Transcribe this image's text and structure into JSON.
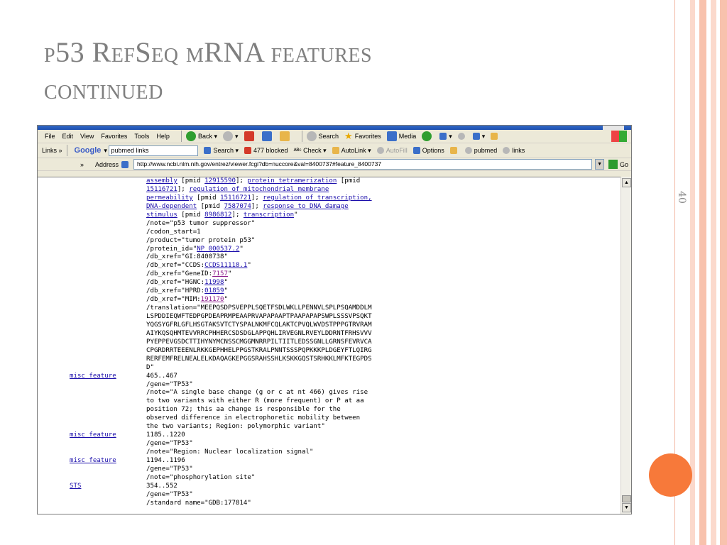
{
  "slide": {
    "title_line1": "p53 RefSeq mRNA features",
    "title_line2": "continued",
    "page_number": "40"
  },
  "browser": {
    "menu": [
      "File",
      "Edit",
      "View",
      "Favorites",
      "Tools",
      "Help"
    ],
    "toolbar": {
      "back": "Back",
      "search": "Search",
      "favorites": "Favorites",
      "media": "Media"
    },
    "links_bar": {
      "links": "Links",
      "google": "Google",
      "search_value": "pubmed links",
      "search": "Search",
      "blocked": "477 blocked",
      "check": "Check",
      "autolink": "AutoLink",
      "autofill": "AutoFill",
      "options": "Options",
      "pubmed": "pubmed",
      "links_btn": "links"
    },
    "address": {
      "label": "Address",
      "url": "http://www.ncbi.nlm.nih.gov/entrez/viewer.fcgi?db=nuccore&val=8400737#feature_8400737",
      "go": "Go"
    }
  },
  "genbank": {
    "top_lines": [
      [
        {
          "t": "assembly",
          "link": true
        },
        " [pmid ",
        {
          "t": "12915590",
          "link": true
        },
        "]; ",
        {
          "t": "protein tetramerization",
          "link": true
        },
        " [pmid"
      ],
      [
        {
          "t": "15116721",
          "link": true
        },
        "]; ",
        {
          "t": "regulation of mitochondrial membrane",
          "link": true
        }
      ],
      [
        {
          "t": "permeability",
          "link": true
        },
        " [pmid ",
        {
          "t": "15116721",
          "link": true
        },
        "]; ",
        {
          "t": "regulation of transcription,",
          "link": true
        }
      ],
      [
        {
          "t": "DNA-dependent",
          "link": true
        },
        " [pmid ",
        {
          "t": "7587074",
          "link": true
        },
        "]; ",
        {
          "t": "response to DNA damage",
          "link": true
        }
      ],
      [
        {
          "t": "stimulus",
          "link": true
        },
        " [pmid ",
        {
          "t": "8986812",
          "link": true
        },
        "]; ",
        {
          "t": "transcription",
          "link": true
        },
        "\""
      ],
      [
        "/note=\"p53 tumor suppressor\""
      ],
      [
        "/codon_start=1"
      ],
      [
        "/product=\"tumor protein p53\""
      ],
      [
        "/protein_id=\"",
        {
          "t": "NP_000537.2",
          "link": true
        },
        "\""
      ],
      [
        "/db_xref=\"GI:8400738\""
      ],
      [
        "/db_xref=\"CCDS:",
        {
          "t": "CCDS11118.1",
          "link": true
        },
        "\""
      ],
      [
        "/db_xref=\"GeneID:",
        {
          "t": "7157",
          "link": true,
          "visited": true
        },
        "\""
      ],
      [
        "/db_xref=\"HGNC:",
        {
          "t": "11998",
          "link": true
        },
        "\""
      ],
      [
        "/db_xref=\"HPRD:",
        {
          "t": "01859",
          "link": true
        },
        "\""
      ],
      [
        "/db_xref=\"MIM:",
        {
          "t": "191170",
          "link": true,
          "visited": true
        },
        "\""
      ],
      [
        "/translation=\"MEEPQSDPSVEPPLSQETFSDLWKLLPENNVLSPLPSQAMDDLM"
      ],
      [
        "LSPDDIEQWFTEDPGPDEAPRMPEAAPRVAPAPAAPTPAAPAPAPSWPLSSSVPSQKT"
      ],
      [
        "YQGSYGFRLGFLHSGTAKSVTCTYSPALNKMFCQLAKTCPVQLWVDSTPPPGTRVRAM"
      ],
      [
        "AIYKQSQHMTEVVRRCPHHERCSDSDGLAPPQHLIRVEGNLRVEYLDDRNTFRHSVVV"
      ],
      [
        "PYEPPEVGSDCTTIHYNYMCNSSCMGGMNRRPILTIITLEDSSGNLLGRNSFEVRVCA"
      ],
      [
        "CPGRDRRTEEENLRKKGEPHHELPPGSTKRALPNNTSSSPQPKKKPLDGEYFTLQIRG"
      ],
      [
        "RERFEMFRELNEALELKDAQAGKEPGGSRAHSSHLKSKKGQSTSRHKKLMFKTEGPDS"
      ],
      [
        "D\""
      ]
    ],
    "features": [
      {
        "key": "misc_feature",
        "lines": [
          "465..467",
          "/gene=\"TP53\"",
          "/note=\"A single base change (g or c at nt 466) gives rise",
          "to two variants with either R (more frequent) or P at aa",
          "position 72; this aa change is responsible for the",
          "observed difference in electrophoretic mobility between",
          "the two variants; Region: polymorphic variant\""
        ]
      },
      {
        "key": "misc_feature",
        "lines": [
          "1185..1220",
          "/gene=\"TP53\"",
          "/note=\"Region: Nuclear localization signal\""
        ]
      },
      {
        "key": "misc_feature",
        "lines": [
          "1194..1196",
          "/gene=\"TP53\"",
          "/note=\"phosphorylation site\""
        ]
      },
      {
        "key": "STS",
        "lines": [
          "354..552",
          "/gene=\"TP53\"",
          "/standard name=\"GDB:177814\""
        ]
      }
    ]
  }
}
